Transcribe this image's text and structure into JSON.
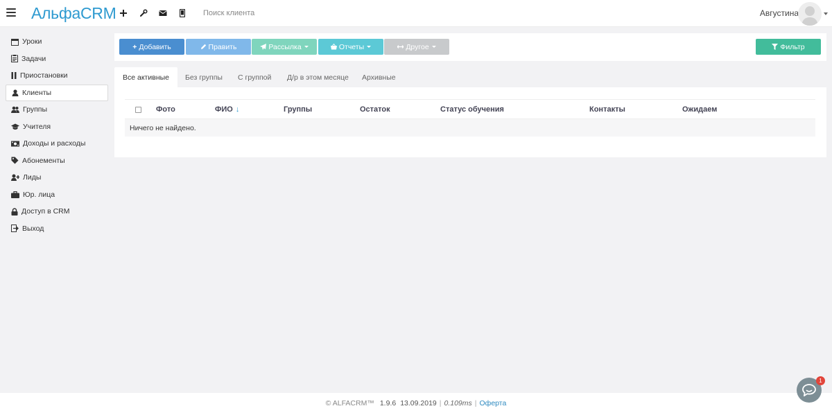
{
  "header": {
    "logo": "АльфаCRM",
    "search_placeholder": "Поиск клиента",
    "user_name": "Августина"
  },
  "sidebar": {
    "items": [
      {
        "label": "Уроки",
        "icon": "calendar-icon"
      },
      {
        "label": "Задачи",
        "icon": "clipboard-icon"
      },
      {
        "label": "Приостановки",
        "icon": "pause-icon"
      },
      {
        "label": "Клиенты",
        "icon": "user-icon",
        "active": true
      },
      {
        "label": "Группы",
        "icon": "users-icon"
      },
      {
        "label": "Учителя",
        "icon": "graduation-cap-icon"
      },
      {
        "label": "Доходы и расходы",
        "icon": "money-icon"
      },
      {
        "label": "Абонементы",
        "icon": "tag-icon"
      },
      {
        "label": "Лиды",
        "icon": "user-plus-icon"
      },
      {
        "label": "Юр. лица",
        "icon": "briefcase-icon"
      },
      {
        "label": "Доступ в CRM",
        "icon": "lock-icon"
      },
      {
        "label": "Выход",
        "icon": "sign-out-icon"
      }
    ]
  },
  "toolbar": {
    "add_label": "Добавить",
    "edit_label": "Править",
    "mailing_label": "Рассылка",
    "reports_label": "Отчеты",
    "other_label": "Другое",
    "filter_label": "Фильтр"
  },
  "tabs": [
    {
      "label": "Все активные",
      "active": true
    },
    {
      "label": "Без группы"
    },
    {
      "label": "С группой"
    },
    {
      "label": "Д/р в этом месяце"
    },
    {
      "label": "Архивные"
    }
  ],
  "table": {
    "columns": [
      "Фото",
      "ФИО",
      "Группы",
      "Остаток",
      "Статус обучения",
      "Контакты",
      "Ожидаем"
    ],
    "sort_indicator": "↓",
    "empty_text": "Ничего не найдено."
  },
  "footer": {
    "brand": "© ALFACRM™",
    "version": "1.9.6",
    "date": "13.09.2019",
    "timing": "0.109ms",
    "oferta": "Оферта"
  },
  "chat": {
    "badge": "1"
  },
  "colors": {
    "logo": "#2e9ad0",
    "add_button": "#4a8ed0",
    "edit_button": "#80b8ea",
    "mailing_button": "#7fd5bd",
    "reports_button": "#5cc9d6",
    "other_button": "#c8cacc",
    "filter_button": "#42bc9b",
    "background": "#f2f2f4"
  }
}
